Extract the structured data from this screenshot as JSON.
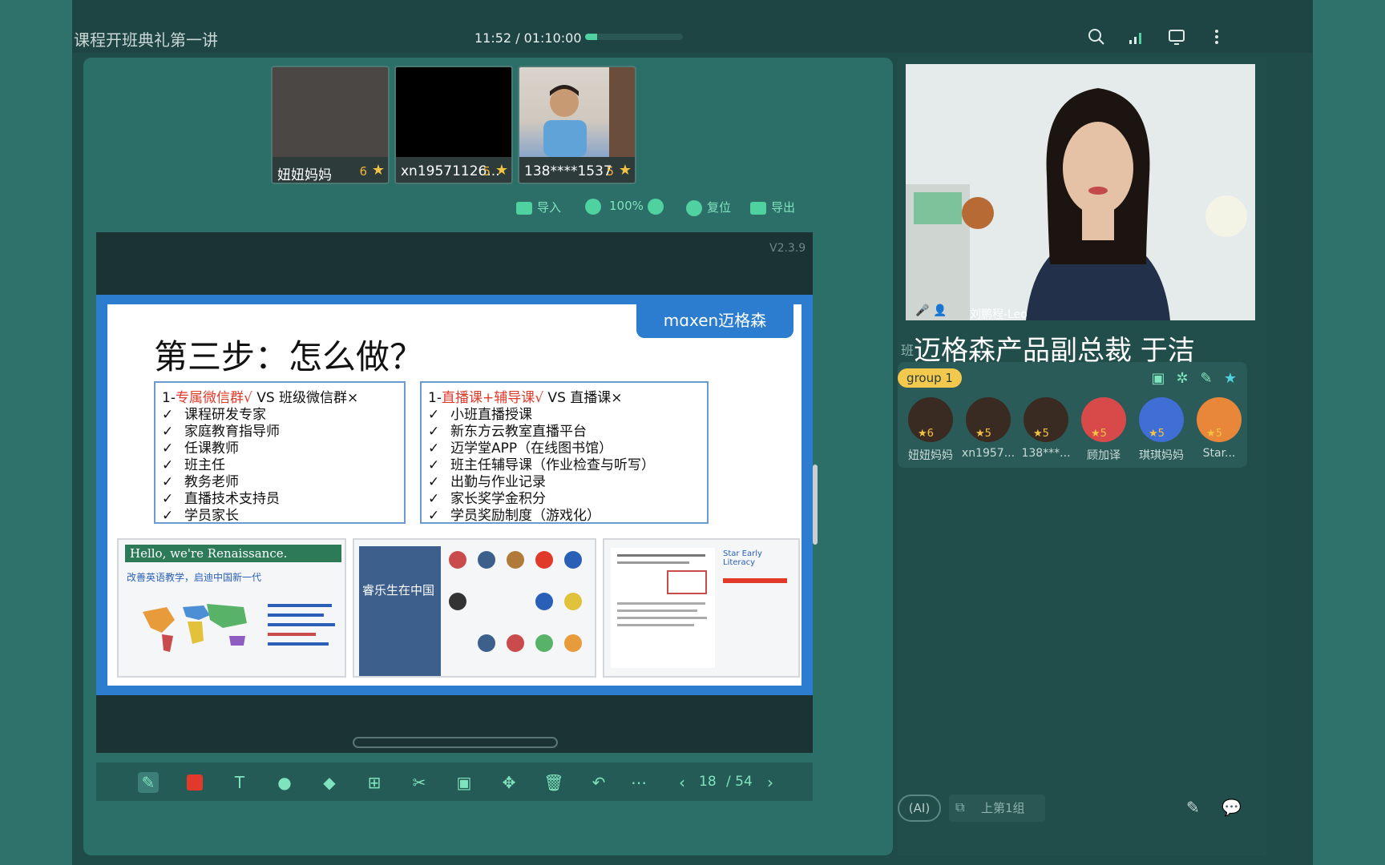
{
  "header": {
    "title": "课程开班典礼第一讲",
    "time_elapsed": "11:52",
    "time_total": "01:10:00",
    "time_separator": " / ",
    "progress_fraction": 0.12,
    "icons": [
      "search-zoom-icon",
      "signal-icon",
      "screen-icon",
      "more-icon"
    ]
  },
  "students": [
    {
      "name": "妞妞妈妈",
      "score": "6",
      "video": "dim"
    },
    {
      "name": "xn19571126...",
      "score": "5",
      "video": "black"
    },
    {
      "name": "138****1537",
      "score": "5",
      "video": "child"
    }
  ],
  "board_tools": {
    "import_label": "导入",
    "zoom": "100%",
    "reset_label": "复位",
    "export_label": "导出"
  },
  "canvas": {
    "version": "V2.3.9"
  },
  "slide": {
    "logo": "mɑxen迈格森",
    "heading": "第三步：怎么做？",
    "box1": {
      "prefix": "1-",
      "highlight": "专属微信群√",
      "rest": " VS 班级微信群×",
      "items": [
        "课程研发专家",
        "家庭教育指导师",
        "任课教师",
        "班主任",
        "教务老师",
        "直播技术支持员",
        "学员家长"
      ]
    },
    "box2": {
      "prefix": "1-",
      "highlight": "直播课+辅导课√",
      "rest": " VS 直播课×",
      "items": [
        "小班直播授课",
        "新东方云教室直播平台",
        "迈学堂APP（在线图书馆）",
        "班主任辅导课（作业检查与听写）",
        "出勤与作业记录",
        "家长奖学金积分",
        "学员奖励制度（游戏化）"
      ]
    },
    "card1": {
      "title": "Hello, we're Renaissance.",
      "subtitle": "改善英语教学，启迪中国新一代"
    },
    "card2": {
      "title": "睿乐生在中国"
    },
    "card3": {
      "title": "Star Early Literacy"
    }
  },
  "pagination": {
    "current": "18",
    "total": "/ 54"
  },
  "teacher": {
    "name_label": "刘鹏程-Leo",
    "caption": "迈格森产品副总裁 于洁",
    "caption_prefix": "班"
  },
  "group": {
    "name": "group 1",
    "members": [
      {
        "name": "妞妞妈妈",
        "score": "6",
        "avatar": "dark"
      },
      {
        "name": "xn1957...",
        "score": "5",
        "avatar": "dark"
      },
      {
        "name": "138***...",
        "score": "5",
        "avatar": "dark"
      },
      {
        "name": "顾加译",
        "score": "5",
        "avatar": "red"
      },
      {
        "name": "琪琪妈妈",
        "score": "5",
        "avatar": "blue"
      },
      {
        "name": "Star...",
        "score": "5",
        "avatar": "orange"
      }
    ]
  },
  "bottom_right": {
    "ai_label": "(AI)",
    "stage_label": "上第1组"
  },
  "colors": {
    "accent": "#4fd1a0",
    "slide_blue": "#2c7dd0",
    "highlight_red": "#e23a2a",
    "star_gold": "#f5c343"
  }
}
